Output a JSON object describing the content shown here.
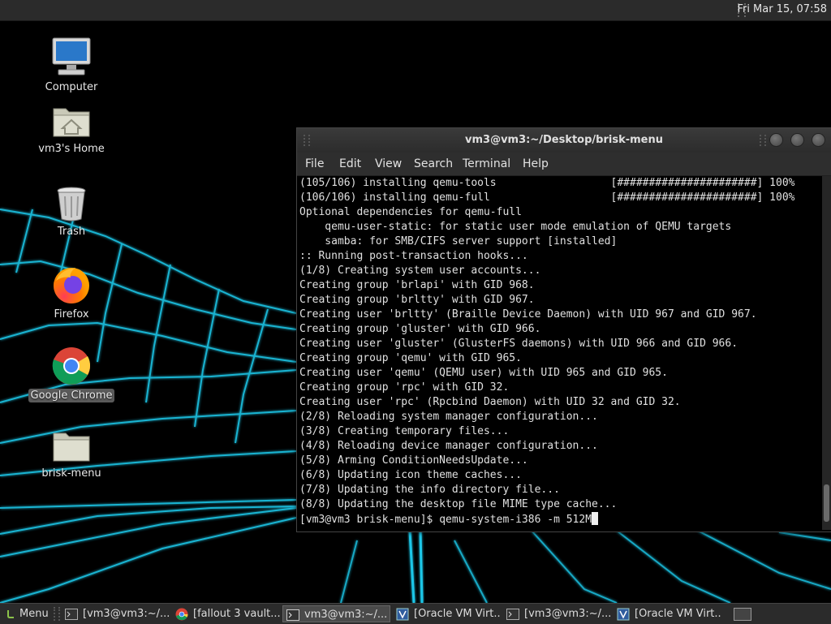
{
  "top_panel": {
    "clock": "Fri Mar 15, 07:58"
  },
  "desktop": {
    "icons": [
      {
        "label": "Computer"
      },
      {
        "label": "vm3's Home"
      },
      {
        "label": "Trash"
      },
      {
        "label": "Firefox"
      },
      {
        "label": "Google Chrome"
      },
      {
        "label": "brisk-menu"
      }
    ]
  },
  "terminal": {
    "title": "vm3@vm3:~/Desktop/brisk-menu",
    "menu": [
      "File",
      "Edit",
      "View",
      "Search",
      "Terminal",
      "Help"
    ],
    "lines": [
      "(105/106) installing qemu-tools                  [######################] 100%",
      "(106/106) installing qemu-full                   [######################] 100%",
      "Optional dependencies for qemu-full",
      "    qemu-user-static: for static user mode emulation of QEMU targets",
      "    samba: for SMB/CIFS server support [installed]",
      ":: Running post-transaction hooks...",
      "(1/8) Creating system user accounts...",
      "Creating group 'brlapi' with GID 968.",
      "Creating group 'brltty' with GID 967.",
      "Creating user 'brltty' (Braille Device Daemon) with UID 967 and GID 967.",
      "Creating group 'gluster' with GID 966.",
      "Creating user 'gluster' (GlusterFS daemons) with UID 966 and GID 966.",
      "Creating group 'qemu' with GID 965.",
      "Creating user 'qemu' (QEMU user) with UID 965 and GID 965.",
      "Creating group 'rpc' with GID 32.",
      "Creating user 'rpc' (Rpcbind Daemon) with UID 32 and GID 32.",
      "(2/8) Reloading system manager configuration...",
      "(3/8) Creating temporary files...",
      "(4/8) Reloading device manager configuration...",
      "(5/8) Arming ConditionNeedsUpdate...",
      "(6/8) Updating icon theme caches...",
      "(7/8) Updating the info directory file...",
      "(8/8) Updating the desktop file MIME type cache..."
    ],
    "prompt": "[vm3@vm3 brisk-menu]$ ",
    "command": "qemu-system-i386 -m 512M"
  },
  "taskbar": {
    "menu_label": "Menu",
    "tasks": [
      {
        "label": "[vm3@vm3:~/...",
        "icon": "terminal-icon"
      },
      {
        "label": "[fallout 3 vault...",
        "icon": "chrome-icon"
      },
      {
        "label": "vm3@vm3:~/...",
        "icon": "terminal-icon"
      },
      {
        "label": "[Oracle VM Virt...",
        "icon": "virtualbox-icon"
      },
      {
        "label": "[vm3@vm3:~/...",
        "icon": "terminal-icon"
      },
      {
        "label": "[Oracle VM Virt...",
        "icon": "virtualbox-icon"
      }
    ]
  }
}
